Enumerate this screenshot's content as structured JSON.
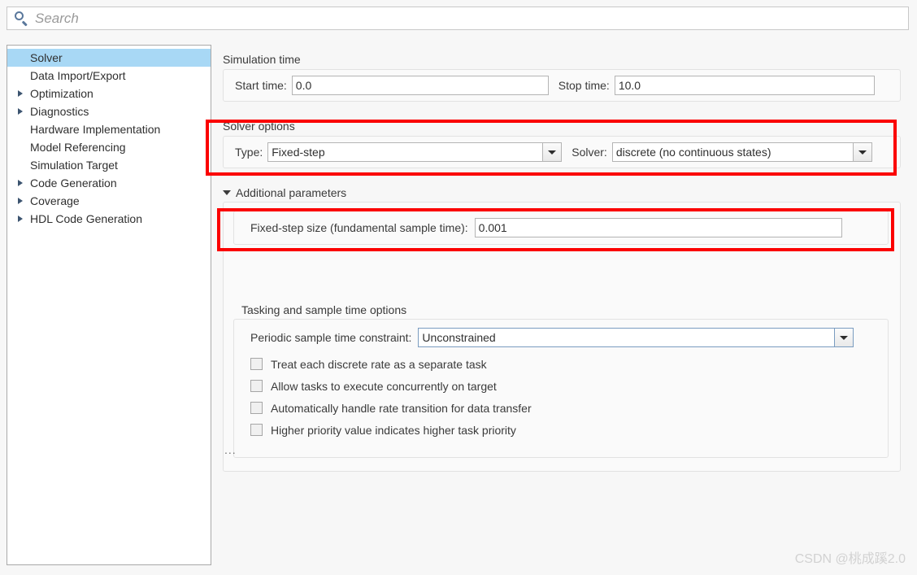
{
  "search": {
    "placeholder": "Search",
    "icon": "search-icon"
  },
  "sidebar": {
    "items": [
      {
        "label": "Solver",
        "expandable": false,
        "selected": true
      },
      {
        "label": "Data Import/Export",
        "expandable": false,
        "selected": false
      },
      {
        "label": "Optimization",
        "expandable": true,
        "selected": false
      },
      {
        "label": "Diagnostics",
        "expandable": true,
        "selected": false
      },
      {
        "label": "Hardware Implementation",
        "expandable": false,
        "selected": false
      },
      {
        "label": "Model Referencing",
        "expandable": false,
        "selected": false
      },
      {
        "label": "Simulation Target",
        "expandable": false,
        "selected": false
      },
      {
        "label": "Code Generation",
        "expandable": true,
        "selected": false
      },
      {
        "label": "Coverage",
        "expandable": true,
        "selected": false
      },
      {
        "label": "HDL Code Generation",
        "expandable": true,
        "selected": false
      }
    ]
  },
  "simulation_time": {
    "title": "Simulation time",
    "start_label": "Start time:",
    "start_value": "0.0",
    "stop_label": "Stop time:",
    "stop_value": "10.0"
  },
  "solver_options": {
    "title": "Solver options",
    "type_label": "Type:",
    "type_value": "Fixed-step",
    "solver_label": "Solver:",
    "solver_value": "discrete (no continuous states)"
  },
  "additional_parameters": {
    "title": "Additional parameters",
    "expanded": true,
    "fixed_step_label": "Fixed-step size (fundamental sample time):",
    "fixed_step_value": "0.001",
    "tasking": {
      "title": "Tasking and sample time options",
      "periodic_label": "Periodic sample time constraint:",
      "periodic_value": "Unconstrained",
      "checkboxes": [
        {
          "label": "Treat each discrete rate as a separate task",
          "checked": false
        },
        {
          "label": "Allow tasks to execute concurrently on target",
          "checked": false
        },
        {
          "label": "Automatically handle rate transition for data transfer",
          "checked": false
        },
        {
          "label": "Higher priority value indicates higher task priority",
          "checked": false
        }
      ]
    }
  },
  "overflow_indicator": "...",
  "watermark": "CSDN @桃成蹊2.0",
  "colors": {
    "annotation": "#fb0000",
    "selection": "#a8d8f5",
    "search_icon": "#5a789c"
  }
}
